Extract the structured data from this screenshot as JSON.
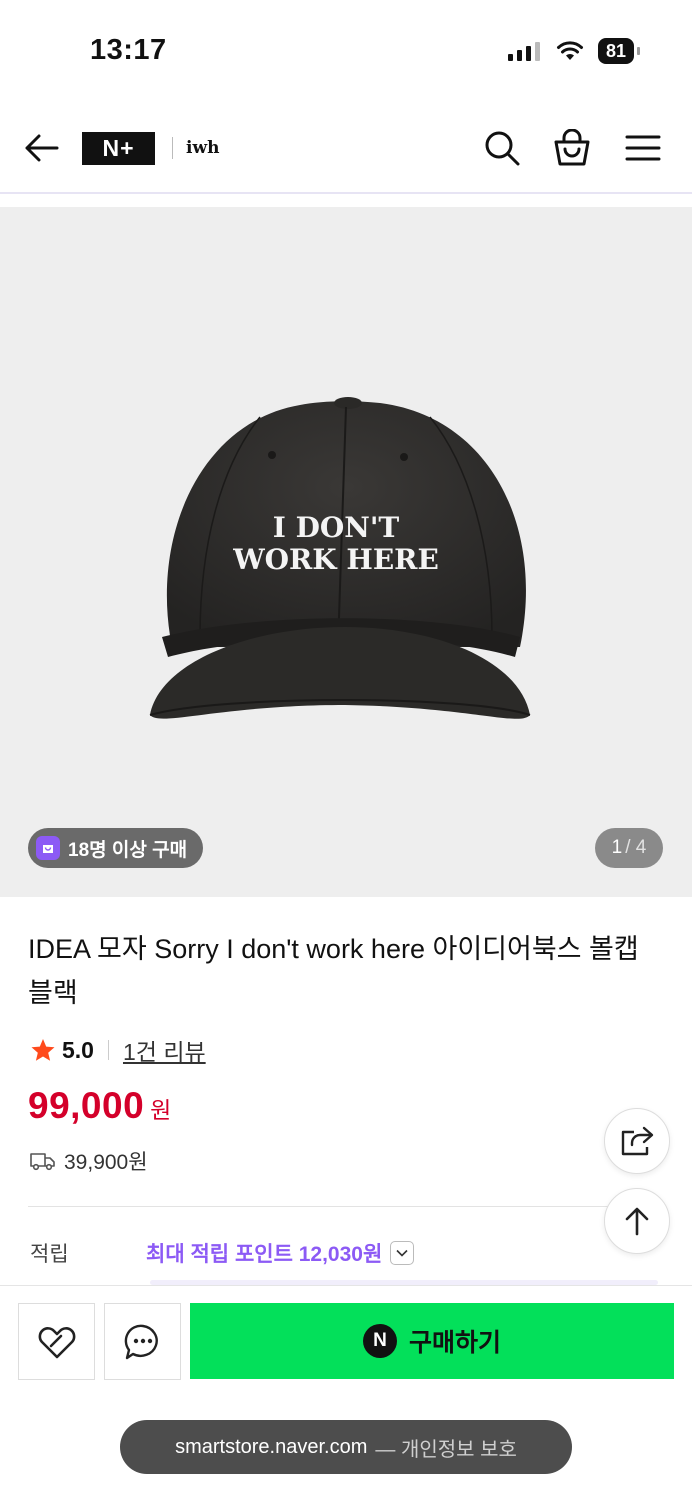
{
  "status_bar": {
    "time": "13:17",
    "battery": "81"
  },
  "header": {
    "logo": "N+",
    "brand": "iwh"
  },
  "gallery": {
    "hat_text_line1": "I DON'T",
    "hat_text_line2": "WORK HERE",
    "buyers_badge": "18명 이상 구매",
    "page_current": "1",
    "page_total": "/ 4"
  },
  "product": {
    "title": "IDEA 모자 Sorry I don't work here 아이디어북스 볼캡 블랙",
    "rating": "5.0",
    "reviews": "1건 리뷰",
    "price": "99,000",
    "price_unit": "원",
    "shipping_fee": "39,900원",
    "points_label": "적립",
    "points_value": "최대 적립 포인트 12,030원"
  },
  "bottom_bar": {
    "buy_label": "구매하기",
    "npay_letter": "N"
  },
  "browser": {
    "url": "smartstore.naver.com",
    "privacy": "— 개인정보 보호"
  },
  "colors": {
    "accent_purple": "#8c5af5",
    "price_red": "#d4002a",
    "buy_green": "#03e05a",
    "star": "#ff4a1c"
  }
}
